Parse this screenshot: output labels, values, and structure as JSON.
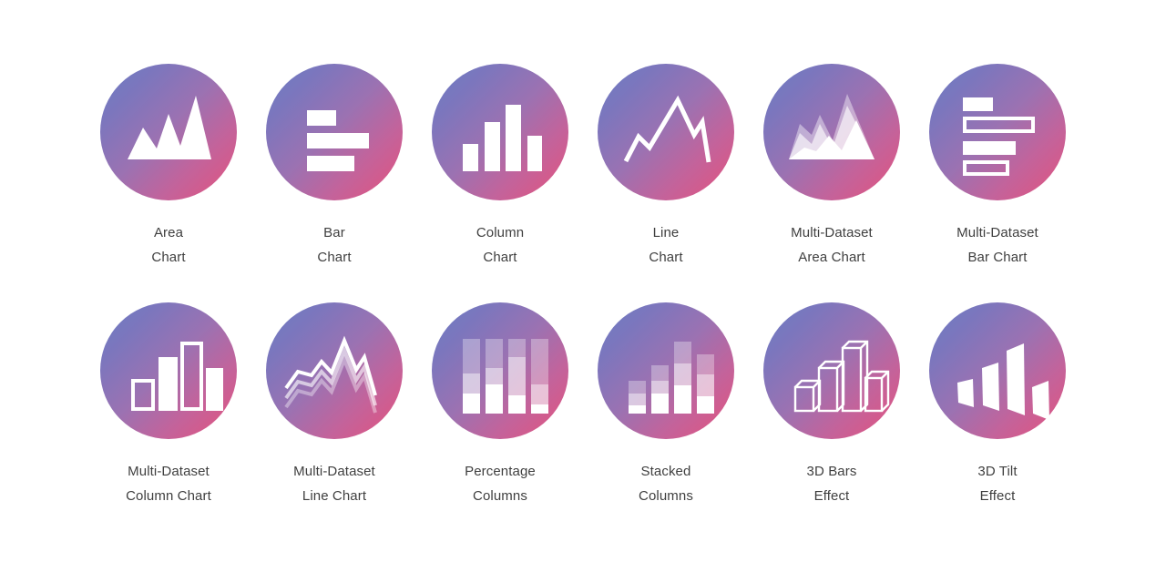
{
  "page": {
    "background_color": "#ffffff",
    "label_color": "#3f3f3f",
    "gradient": {
      "start": "#6a7fc4",
      "mid": "#9b72b2",
      "end": "#e5527c",
      "angle": "135deg"
    },
    "icon_fill": "#ffffff",
    "columns": 6,
    "rows": 2,
    "total_items": 12
  },
  "rows": [
    {
      "items": [
        {
          "icon": "area-chart-icon",
          "line1": "Area",
          "line2": "Chart"
        },
        {
          "icon": "bar-chart-icon",
          "line1": "Bar",
          "line2": "Chart"
        },
        {
          "icon": "column-chart-icon",
          "line1": "Column",
          "line2": "Chart"
        },
        {
          "icon": "line-chart-icon",
          "line1": "Line",
          "line2": "Chart"
        },
        {
          "icon": "multi-dataset-area-chart-icon",
          "line1": "Multi-Dataset",
          "line2": "Area Chart"
        },
        {
          "icon": "multi-dataset-bar-chart-icon",
          "line1": "Multi-Dataset",
          "line2": "Bar Chart"
        }
      ]
    },
    {
      "items": [
        {
          "icon": "multi-dataset-column-chart-icon",
          "line1": "Multi-Dataset",
          "line2": "Column Chart"
        },
        {
          "icon": "multi-dataset-line-chart-icon",
          "line1": "Multi-Dataset",
          "line2": "Line Chart"
        },
        {
          "icon": "percentage-columns-icon",
          "line1": "Percentage",
          "line2": "Columns"
        },
        {
          "icon": "stacked-columns-icon",
          "line1": "Stacked",
          "line2": "Columns"
        },
        {
          "icon": "3d-bars-effect-icon",
          "line1": "3D Bars",
          "line2": "Effect"
        },
        {
          "icon": "3d-tilt-effect-icon",
          "line1": "3D Tilt",
          "line2": "Effect"
        }
      ]
    }
  ]
}
